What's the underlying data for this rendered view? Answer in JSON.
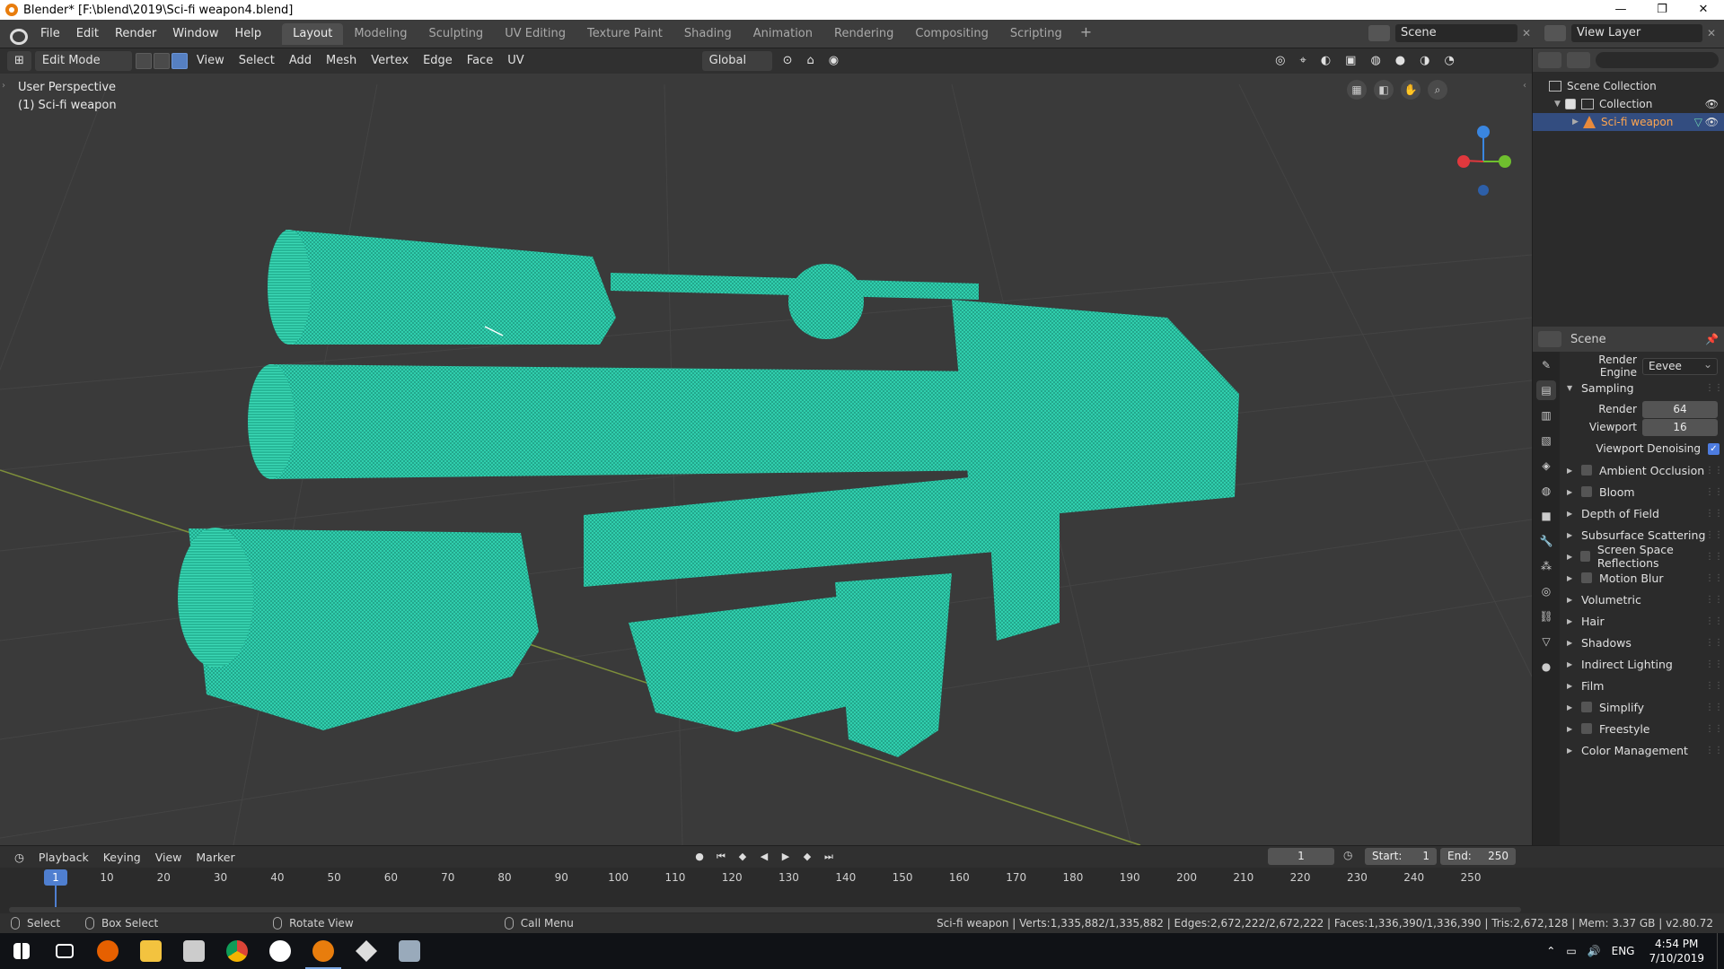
{
  "window": {
    "title": "Blender* [F:\\blend\\2019\\Sci-fi weapon4.blend]",
    "controls": [
      "—",
      "❐",
      "✕"
    ]
  },
  "menu": [
    "File",
    "Edit",
    "Render",
    "Window",
    "Help"
  ],
  "workspaces": [
    "Layout",
    "Modeling",
    "Sculpting",
    "UV Editing",
    "Texture Paint",
    "Shading",
    "Animation",
    "Rendering",
    "Compositing",
    "Scripting"
  ],
  "workspace_add": "+",
  "scene": {
    "name": "Scene",
    "view_layer": "View Layer"
  },
  "viewport": {
    "mode": "Edit Mode",
    "menus": [
      "View",
      "Select",
      "Add",
      "Mesh",
      "Vertex",
      "Edge",
      "Face",
      "UV"
    ],
    "transform_orientation": "Global",
    "perspective": "User Perspective",
    "object_label": "(1) Sci-fi weapon",
    "mesh_color": "#2bc6a5",
    "gizmo": {
      "x_color": "#e0383d",
      "y_color": "#6fbf2e",
      "z_color": "#3a86e0",
      "z_label": "Z"
    }
  },
  "outliner": {
    "root": "Scene Collection",
    "collection": "Collection",
    "object": "Sci-fi weapon"
  },
  "properties": {
    "scene_label": "Scene",
    "render_engine_label": "Render Engine",
    "render_engine": "Eevee",
    "sampling": "Sampling",
    "render_label": "Render",
    "render_value": "64",
    "viewport_label": "Viewport",
    "viewport_value": "16",
    "viewport_denoising": "Viewport Denoising",
    "panels": [
      {
        "label": "Ambient Occlusion",
        "checkbox": true
      },
      {
        "label": "Bloom",
        "checkbox": true
      },
      {
        "label": "Depth of Field",
        "checkbox": false
      },
      {
        "label": "Subsurface Scattering",
        "checkbox": false
      },
      {
        "label": "Screen Space Reflections",
        "checkbox": true
      },
      {
        "label": "Motion Blur",
        "checkbox": true
      },
      {
        "label": "Volumetric",
        "checkbox": false
      },
      {
        "label": "Hair",
        "checkbox": false
      },
      {
        "label": "Shadows",
        "checkbox": false
      },
      {
        "label": "Indirect Lighting",
        "checkbox": false
      },
      {
        "label": "Film",
        "checkbox": false
      },
      {
        "label": "Simplify",
        "checkbox": true
      },
      {
        "label": "Freestyle",
        "checkbox": true
      },
      {
        "label": "Color Management",
        "checkbox": false
      }
    ]
  },
  "timeline": {
    "menus": [
      "Playback",
      "Keying",
      "View",
      "Marker"
    ],
    "current_frame": "1",
    "start_label": "Start:",
    "start": "1",
    "end_label": "End:",
    "end": "250",
    "ticks": [
      "1",
      "10",
      "20",
      "30",
      "40",
      "50",
      "60",
      "70",
      "80",
      "90",
      "100",
      "110",
      "120",
      "130",
      "140",
      "150",
      "160",
      "170",
      "180",
      "190",
      "200",
      "210",
      "220",
      "230",
      "240",
      "250"
    ]
  },
  "status": {
    "select": "Select",
    "box_select": "Box Select",
    "rotate": "Rotate View",
    "call_menu": "Call Menu",
    "stats": "Sci-fi weapon | Verts:1,335,882/1,335,882 | Edges:2,672,222/2,672,222 | Faces:1,336,390/1,336,390 | Tris:2,672,128 | Mem: 3.37 GB | v2.80.72"
  },
  "taskbar": {
    "lang": "ENG",
    "time": "4:54 PM",
    "date": "7/10/2019"
  }
}
